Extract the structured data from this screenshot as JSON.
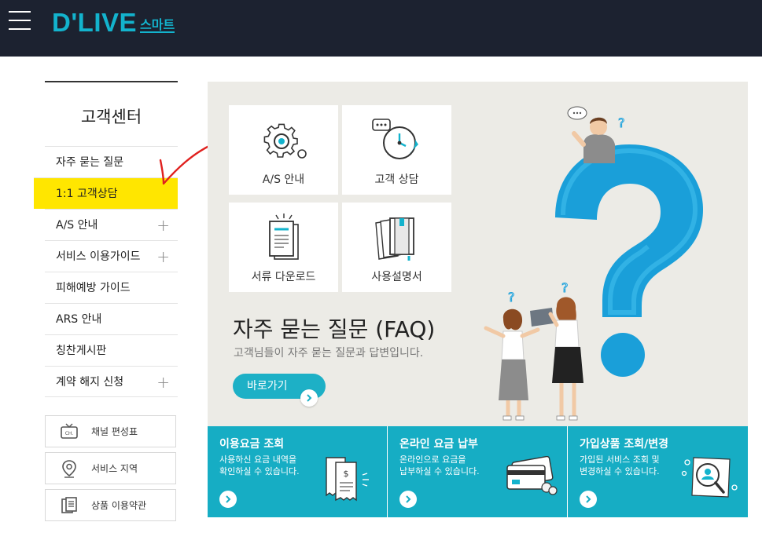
{
  "header": {
    "logo_main": "D'LIVE",
    "logo_sub": "스마트"
  },
  "sidebar": {
    "title": "고객센터",
    "items": [
      {
        "label": "자주 묻는 질문",
        "expandable": false
      },
      {
        "label": "1:1 고객상담",
        "expandable": false,
        "active": true
      },
      {
        "label": "A/S 안내",
        "expandable": true
      },
      {
        "label": "서비스 이용가이드",
        "expandable": true
      },
      {
        "label": "피해예방 가이드",
        "expandable": false
      },
      {
        "label": "ARS 안내",
        "expandable": false
      },
      {
        "label": "칭찬게시판",
        "expandable": false
      },
      {
        "label": "계약 해지 신청",
        "expandable": true
      }
    ],
    "plus": "+",
    "buttons": [
      {
        "label": "채널 편성표",
        "icon": "tv-icon"
      },
      {
        "label": "서비스 지역",
        "icon": "location-pin-icon"
      },
      {
        "label": "상품 이용약관",
        "icon": "document-icon"
      }
    ]
  },
  "main": {
    "tiles": [
      {
        "label": "A/S 안내",
        "icon": "gear-icon"
      },
      {
        "label": "고객 상담",
        "icon": "clock-chat-icon"
      },
      {
        "label": "서류 다운로드",
        "icon": "document-download-icon"
      },
      {
        "label": "사용설명서",
        "icon": "manual-book-icon"
      }
    ],
    "faq_title": "자주 묻는 질문 (FAQ)",
    "faq_subtitle": "고객님들이 자주 묻는 질문과 답변입니다.",
    "go_button": "바로가기"
  },
  "cards": [
    {
      "title": "이용요금 조회",
      "desc": "사용하신 요금 내역을\n확인하실 수 있습니다.",
      "icon": "receipt-icon"
    },
    {
      "title": "온라인 요금 납부",
      "desc": "온라인으로 요금을\n납부하실 수 있습니다.",
      "icon": "credit-card-icon"
    },
    {
      "title": "가입상품 조회/변경",
      "desc": "가입된 서비스 조회 및\n변경하실 수 있습니다.",
      "icon": "magnifier-user-icon"
    }
  ],
  "colors": {
    "header_bg": "#1c2230",
    "brand": "#13b3cd",
    "highlight": "#ffe600",
    "card_bg": "#16adc4",
    "panel_bg": "#ecebe6",
    "annotation": "#e0201e"
  }
}
